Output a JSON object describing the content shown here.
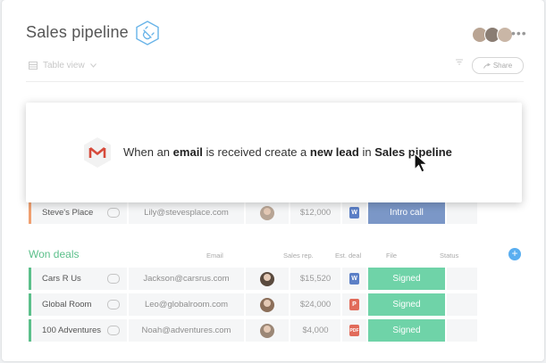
{
  "header": {
    "title": "Sales pipeline",
    "more_label": "•••",
    "view_label": "Table view",
    "share_label": "Share"
  },
  "automation": {
    "part1": "When an",
    "part2": "email",
    "part3": "is received create a",
    "part4": "new lead",
    "part5": "in",
    "part6": "Sales pipeline"
  },
  "groups": [
    {
      "rows": [
        {
          "name": "Steve's Place",
          "email": "Lily@stevesplace.com",
          "deal": "$12,000",
          "file": "W",
          "file_color": "#5b7fc6",
          "status": "Intro call",
          "status_color": "#7b97c7"
        }
      ]
    },
    {
      "title": "Won deals",
      "columns": {
        "email": "Email",
        "rep": "Sales rep.",
        "deal": "Est. deal",
        "file": "File",
        "status": "Status"
      },
      "rows": [
        {
          "name": "Cars R Us",
          "email": "Jackson@carsrus.com",
          "deal": "$15,520",
          "file": "W",
          "file_color": "#5b7fc6",
          "status": "Signed",
          "status_color": "#6fd3a8"
        },
        {
          "name": "Global Room",
          "email": "Leo@globalroom.com",
          "deal": "$24,000",
          "file": "P",
          "file_color": "#e16b5a",
          "status": "Signed",
          "status_color": "#6fd3a8"
        },
        {
          "name": "100 Adventures",
          "email": "Noah@adventures.com",
          "deal": "$4,000",
          "file": "PDF",
          "file_color": "#e16b5a",
          "status": "Signed",
          "status_color": "#6fd3a8"
        }
      ]
    }
  ],
  "colors": {
    "accent": "#5aaef0",
    "group_won": "#5bbf8a",
    "status_signed": "#6fd3a8",
    "status_intro": "#7b97c7"
  }
}
